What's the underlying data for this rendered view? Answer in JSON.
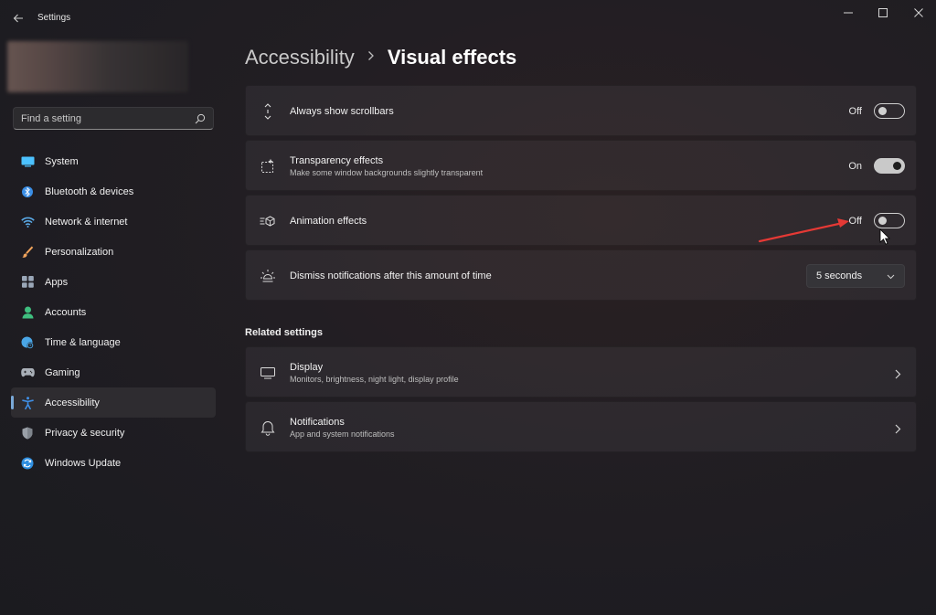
{
  "window": {
    "title": "Settings",
    "back_icon": "back-arrow-icon",
    "controls": [
      "minimize-icon",
      "maximize-icon",
      "close-icon"
    ]
  },
  "search": {
    "placeholder": "Find a setting",
    "icon": "search-icon"
  },
  "sidebar": {
    "items": [
      {
        "label": "System",
        "icon": "system-icon",
        "color": "#4cc2ff"
      },
      {
        "label": "Bluetooth & devices",
        "icon": "bluetooth-icon",
        "color": "#3a8ee6"
      },
      {
        "label": "Network & internet",
        "icon": "wifi-icon",
        "color": "#5aa9e6"
      },
      {
        "label": "Personalization",
        "icon": "brush-icon",
        "color": "#f0a35c"
      },
      {
        "label": "Apps",
        "icon": "apps-icon",
        "color": "#9aa7b8"
      },
      {
        "label": "Accounts",
        "icon": "person-icon",
        "color": "#3fbf7f"
      },
      {
        "label": "Time & language",
        "icon": "globe-clock-icon",
        "color": "#4aa6e6"
      },
      {
        "label": "Gaming",
        "icon": "gamepad-icon",
        "color": "#aab0b8"
      },
      {
        "label": "Accessibility",
        "icon": "accessibility-icon",
        "color": "#3f8fe6",
        "active": true
      },
      {
        "label": "Privacy & security",
        "icon": "shield-icon",
        "color": "#9aa0a8"
      },
      {
        "label": "Windows Update",
        "icon": "update-icon",
        "color": "#2f8fe0"
      }
    ]
  },
  "breadcrumb": {
    "parent": "Accessibility",
    "current": "Visual effects"
  },
  "settings": [
    {
      "title": "Always show scrollbars",
      "subtitle": "",
      "icon": "scrollbar-icon",
      "state_label": "Off",
      "on": false
    },
    {
      "title": "Transparency effects",
      "subtitle": "Make some window backgrounds slightly transparent",
      "icon": "transparency-icon",
      "state_label": "On",
      "on": true
    },
    {
      "title": "Animation effects",
      "subtitle": "",
      "icon": "animation-icon",
      "state_label": "Off",
      "on": false
    },
    {
      "title": "Dismiss notifications after this amount of time",
      "subtitle": "",
      "icon": "sun-timer-icon",
      "dropdown_value": "5 seconds"
    }
  ],
  "related": {
    "heading": "Related settings",
    "items": [
      {
        "title": "Display",
        "subtitle": "Monitors, brightness, night light, display profile",
        "icon": "display-icon"
      },
      {
        "title": "Notifications",
        "subtitle": "App and system notifications",
        "icon": "bell-icon"
      }
    ]
  },
  "annotation": {
    "arrow_color": "#e53935"
  }
}
